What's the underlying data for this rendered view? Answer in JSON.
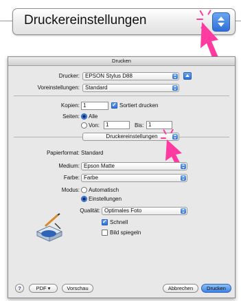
{
  "zoom_popup": {
    "label": "Druckereinstellungen"
  },
  "dialog": {
    "title": "Drucken",
    "printer": {
      "label": "Drucker:",
      "value": "EPSON Stylus D88"
    },
    "presets": {
      "label": "Voreinstellungen:",
      "value": "Standard"
    },
    "copies": {
      "label": "Kopien:",
      "value": "1",
      "collate_label": "Sortiert drucken",
      "collate_checked": true
    },
    "pages": {
      "label": "Seiten:",
      "all_label": "Alle",
      "from_label": "Von:",
      "from_value": "1",
      "to_label": "Bis:",
      "to_value": "1",
      "selected": "Alle"
    },
    "panel_popup": {
      "value": "Druckereinstellungen"
    },
    "paper_format": {
      "label": "Papierformat:",
      "value": "Standard"
    },
    "medium": {
      "label": "Medium:",
      "value": "Epson Matte"
    },
    "color": {
      "label": "Farbe:",
      "value": "Farbe"
    },
    "mode": {
      "label": "Modus:",
      "automatic_label": "Automatisch",
      "settings_label": "Einstellungen",
      "selected": "Einstellungen"
    },
    "quality": {
      "label": "Qualität:",
      "value": "Optimales Foto"
    },
    "fast": {
      "label": "Schnell",
      "checked": true
    },
    "mirror": {
      "label": "Bild spiegeln",
      "checked": false
    },
    "footer": {
      "help": "?",
      "pdf": "PDF ▾",
      "preview": "Vorschau",
      "cancel": "Abbrechen",
      "print": "Drucken"
    }
  },
  "colors": {
    "cursor": "#ff3aa0",
    "accent": "#3d83e6"
  }
}
